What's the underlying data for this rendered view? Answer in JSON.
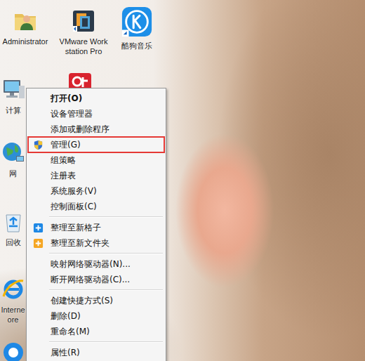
{
  "desktop_icons": [
    {
      "label": "Administrator",
      "kind": "user-folder"
    },
    {
      "label": "VMware Workstation Pro",
      "kind": "vmware"
    },
    {
      "label": "酷狗音乐",
      "kind": "kugou"
    },
    {
      "label": "计算",
      "kind": "computer"
    },
    {
      "label": "",
      "kind": "crossfire"
    },
    {
      "label": "网",
      "kind": "network"
    },
    {
      "label": "回收",
      "kind": "recycle"
    },
    {
      "label": "Interne\nore",
      "kind": "ie"
    },
    {
      "label": "",
      "kind": "blue-app"
    }
  ],
  "context_menu": {
    "items": [
      {
        "kind": "item",
        "label": "打开(O)",
        "bold": true,
        "selected": false
      },
      {
        "kind": "item",
        "label": "设备管理器",
        "bold": false,
        "selected": false
      },
      {
        "kind": "item",
        "label": "添加或删除程序",
        "bold": false,
        "selected": false
      },
      {
        "kind": "admin",
        "label": "管理(G)",
        "bold": false,
        "selected": true
      },
      {
        "kind": "item",
        "label": "组策略",
        "bold": false,
        "selected": false
      },
      {
        "kind": "item",
        "label": "注册表",
        "bold": false,
        "selected": false
      },
      {
        "kind": "item",
        "label": "系统服务(V)",
        "bold": false,
        "selected": false
      },
      {
        "kind": "item",
        "label": "控制面板(C)",
        "bold": false,
        "selected": false
      },
      {
        "kind": "separator"
      },
      {
        "kind": "tag",
        "label": "整理至新格子",
        "bold": false,
        "selected": false,
        "color": "#1e88e5"
      },
      {
        "kind": "tag",
        "label": "整理至新文件夹",
        "bold": false,
        "selected": false,
        "color": "#f5a623"
      },
      {
        "kind": "separator"
      },
      {
        "kind": "item",
        "label": "映射网络驱动器(N)...",
        "bold": false,
        "selected": false
      },
      {
        "kind": "item",
        "label": "断开网络驱动器(C)...",
        "bold": false,
        "selected": false
      },
      {
        "kind": "separator"
      },
      {
        "kind": "item",
        "label": "创建快捷方式(S)",
        "bold": false,
        "selected": false
      },
      {
        "kind": "item",
        "label": "删除(D)",
        "bold": false,
        "selected": false
      },
      {
        "kind": "item",
        "label": "重命名(M)",
        "bold": false,
        "selected": false
      },
      {
        "kind": "separator"
      },
      {
        "kind": "item",
        "label": "属性(R)",
        "bold": false,
        "selected": false
      }
    ]
  }
}
